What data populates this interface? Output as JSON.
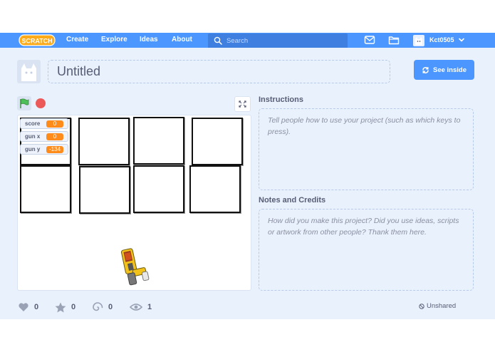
{
  "navbar": {
    "logo_text": "SCRATCH",
    "links": [
      "Create",
      "Explore",
      "Ideas",
      "About"
    ],
    "search_placeholder": "Search",
    "username": "Kct0505"
  },
  "project": {
    "title": "Untitled",
    "see_inside_label": "See inside"
  },
  "stage": {
    "monitors": [
      {
        "label": "score",
        "value": "0"
      },
      {
        "label": "gun x",
        "value": "0"
      },
      {
        "label": "gun y",
        "value": "-134"
      }
    ]
  },
  "instructions": {
    "heading": "Instructions",
    "placeholder": "Tell people how to use your project (such as which keys to press)."
  },
  "notes": {
    "heading": "Notes and Credits",
    "placeholder": "How did you make this project? Did you use ideas, scripts or artwork from other people? Thank them here."
  },
  "stats": {
    "loves": "0",
    "favorites": "0",
    "remixes": "0",
    "views": "1"
  },
  "share_status": "Unshared",
  "colors": {
    "brand": "#4c97ff",
    "background": "#e9f1fc",
    "monitor_value": "#ff8c1a",
    "stop": "#ec5959",
    "flag": "#4cbf56"
  }
}
